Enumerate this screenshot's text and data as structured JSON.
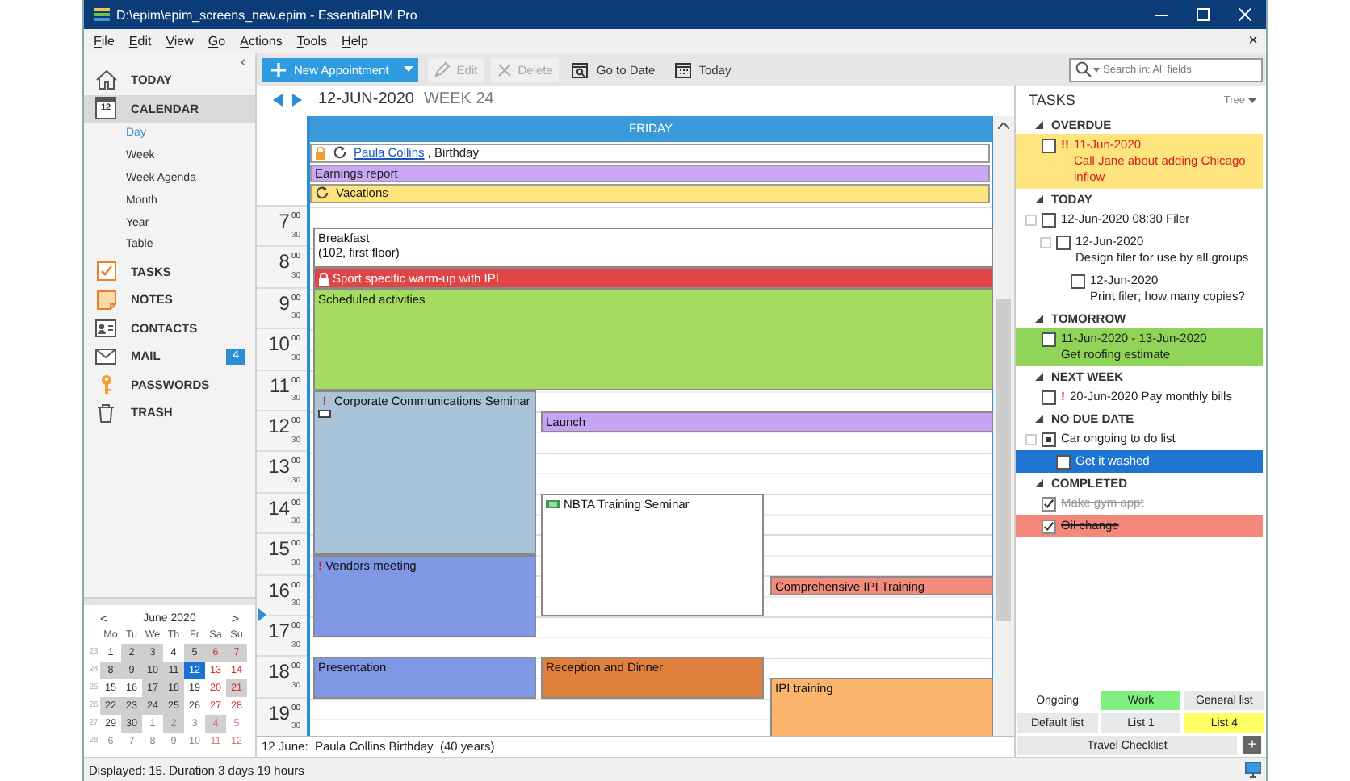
{
  "window": {
    "title": "D:\\epim\\epim_screens_new.epim - EssentialPIM Pro"
  },
  "menu": {
    "items": [
      "File",
      "Edit",
      "View",
      "Go",
      "Actions",
      "Tools",
      "Help"
    ],
    "close": "×"
  },
  "sidebar": {
    "collapse": "‹",
    "items": [
      {
        "label": "TODAY",
        "selected": false
      },
      {
        "label": "CALENDAR",
        "selected": true,
        "icon_label": "12",
        "children": [
          {
            "label": "Day",
            "selected": true
          },
          {
            "label": "Week",
            "selected": false
          },
          {
            "label": "Week Agenda",
            "selected": false
          },
          {
            "label": "Month",
            "selected": false
          },
          {
            "label": "Year",
            "selected": false
          },
          {
            "label": "Table",
            "selected": false
          }
        ]
      },
      {
        "label": "TASKS",
        "selected": false
      },
      {
        "label": "NOTES",
        "selected": false
      },
      {
        "label": "CONTACTS",
        "selected": false
      },
      {
        "label": "MAIL",
        "selected": false,
        "badge": "4"
      },
      {
        "label": "PASSWORDS",
        "selected": false
      },
      {
        "label": "TRASH",
        "selected": false
      }
    ]
  },
  "mini_calendar": {
    "prev": "<",
    "title": "June 2020",
    "next": ">",
    "weekdays": [
      "Mo",
      "Tu",
      "We",
      "Th",
      "Fr",
      "Sa",
      "Su"
    ],
    "weeks": [
      {
        "number": "23",
        "days": [
          {
            "day": "1",
            "other_month": false,
            "busy": false,
            "selected": false
          },
          {
            "day": "2",
            "other_month": false,
            "busy": true,
            "selected": false
          },
          {
            "day": "3",
            "other_month": false,
            "busy": true,
            "selected": false
          },
          {
            "day": "4",
            "other_month": false,
            "busy": false,
            "selected": false
          },
          {
            "day": "5",
            "other_month": false,
            "busy": true,
            "selected": false
          },
          {
            "day": "6",
            "other_month": false,
            "busy": true,
            "selected": false
          },
          {
            "day": "7",
            "other_month": false,
            "busy": true,
            "selected": false
          }
        ]
      },
      {
        "number": "24",
        "days": [
          {
            "day": "8",
            "other_month": false,
            "busy": true,
            "selected": false
          },
          {
            "day": "9",
            "other_month": false,
            "busy": true,
            "selected": false
          },
          {
            "day": "10",
            "other_month": false,
            "busy": true,
            "selected": false
          },
          {
            "day": "11",
            "other_month": false,
            "busy": true,
            "selected": false
          },
          {
            "day": "12",
            "other_month": false,
            "busy": false,
            "selected": true
          },
          {
            "day": "13",
            "other_month": false,
            "busy": false,
            "selected": false
          },
          {
            "day": "14",
            "other_month": false,
            "busy": false,
            "selected": false
          }
        ]
      },
      {
        "number": "25",
        "days": [
          {
            "day": "15",
            "other_month": false,
            "busy": false,
            "selected": false
          },
          {
            "day": "16",
            "other_month": false,
            "busy": false,
            "selected": false
          },
          {
            "day": "17",
            "other_month": false,
            "busy": true,
            "selected": false
          },
          {
            "day": "18",
            "other_month": false,
            "busy": true,
            "selected": false
          },
          {
            "day": "19",
            "other_month": false,
            "busy": false,
            "selected": false
          },
          {
            "day": "20",
            "other_month": false,
            "busy": false,
            "selected": false
          },
          {
            "day": "21",
            "other_month": false,
            "busy": true,
            "selected": false
          }
        ]
      },
      {
        "number": "26",
        "days": [
          {
            "day": "22",
            "other_month": false,
            "busy": true,
            "selected": false
          },
          {
            "day": "23",
            "other_month": false,
            "busy": true,
            "selected": false
          },
          {
            "day": "24",
            "other_month": false,
            "busy": true,
            "selected": false
          },
          {
            "day": "25",
            "other_month": false,
            "busy": true,
            "selected": false
          },
          {
            "day": "26",
            "other_month": false,
            "busy": false,
            "selected": false
          },
          {
            "day": "27",
            "other_month": false,
            "busy": false,
            "selected": false
          },
          {
            "day": "28",
            "other_month": false,
            "busy": false,
            "selected": false
          }
        ]
      },
      {
        "number": "27",
        "days": [
          {
            "day": "29",
            "other_month": false,
            "busy": false,
            "selected": false
          },
          {
            "day": "30",
            "other_month": false,
            "busy": true,
            "selected": false
          },
          {
            "day": "1",
            "other_month": true,
            "busy": false,
            "selected": false
          },
          {
            "day": "2",
            "other_month": true,
            "busy": true,
            "selected": false
          },
          {
            "day": "3",
            "other_month": true,
            "busy": false,
            "selected": false
          },
          {
            "day": "4",
            "other_month": true,
            "busy": true,
            "selected": false
          },
          {
            "day": "5",
            "other_month": true,
            "busy": false,
            "selected": false
          }
        ]
      },
      {
        "number": "28",
        "days": [
          {
            "day": "6",
            "other_month": true,
            "busy": false,
            "selected": false
          },
          {
            "day": "7",
            "other_month": true,
            "busy": false,
            "selected": false
          },
          {
            "day": "8",
            "other_month": true,
            "busy": false,
            "selected": false
          },
          {
            "day": "9",
            "other_month": true,
            "busy": false,
            "selected": false
          },
          {
            "day": "10",
            "other_month": true,
            "busy": false,
            "selected": false
          },
          {
            "day": "11",
            "other_month": true,
            "busy": false,
            "selected": false
          },
          {
            "day": "12",
            "other_month": true,
            "busy": false,
            "selected": false
          }
        ]
      }
    ]
  },
  "toolbar": {
    "new_button": "New Appointment",
    "buttons": [
      {
        "label": "Edit",
        "disabled": true
      },
      {
        "label": "Delete",
        "disabled": true
      },
      {
        "label": "Go to Date",
        "disabled": false
      },
      {
        "label": "Today",
        "disabled": false
      }
    ],
    "search": {
      "placeholder": "Search in: All fields"
    }
  },
  "calendar": {
    "date": "12-JUN-2020",
    "week": "WEEK 24",
    "day_name": "FRIDAY",
    "all_day": [
      {
        "link": "Paula Collins",
        "title": ", Birthday",
        "color": "#ffffff",
        "locked": true,
        "recurring": true
      },
      {
        "title": "Earnings report",
        "color": "#c9a7f4",
        "locked": false,
        "recurring": false
      },
      {
        "title": "Vacations",
        "color": "#fde47c",
        "locked": false,
        "recurring": true
      }
    ],
    "hours": [
      {
        "hour": "7",
        "minutes": "00",
        "half": "30"
      },
      {
        "hour": "8",
        "minutes": "00",
        "half": "30"
      },
      {
        "hour": "9",
        "minutes": "00",
        "half": "30"
      },
      {
        "hour": "10",
        "minutes": "00",
        "half": "30"
      },
      {
        "hour": "11",
        "minutes": "00",
        "half": "30"
      },
      {
        "hour": "12",
        "minutes": "00",
        "half": "30"
      },
      {
        "hour": "13",
        "minutes": "00",
        "half": "30"
      },
      {
        "hour": "14",
        "minutes": "00",
        "half": "30"
      },
      {
        "hour": "15",
        "minutes": "00",
        "half": "30"
      },
      {
        "hour": "16",
        "minutes": "00",
        "half": "30"
      },
      {
        "hour": "17",
        "minutes": "00",
        "half": "30"
      },
      {
        "hour": "18",
        "minutes": "00",
        "half": "30"
      },
      {
        "hour": "19",
        "minutes": "00",
        "half": "30"
      }
    ],
    "events": [
      {
        "lines": [
          "Breakfast",
          "(102, first floor)"
        ],
        "color": "#ffffff",
        "locked": false,
        "note": false,
        "category": false
      },
      {
        "lines": [
          "Sport specific warm-up with IPI"
        ],
        "color": "#e14444",
        "locked": true,
        "note": false,
        "category": false
      },
      {
        "lines": [
          "Scheduled activities"
        ],
        "color": "#a6dc5f",
        "locked": false,
        "note": false,
        "category": false
      },
      {
        "lines": [
          "Corporate Communications Seminar"
        ],
        "color": "#a9c4d8",
        "locked": false,
        "priority": "!",
        "note": true,
        "category": false
      },
      {
        "lines": [
          "Launch"
        ],
        "color": "#c5a4f4",
        "locked": false,
        "note": false,
        "category": false
      },
      {
        "lines": [
          "NBTA Training Seminar"
        ],
        "color": "#ffffff",
        "locked": false,
        "note": false,
        "category": true
      },
      {
        "lines": [
          "Vendors meeting"
        ],
        "color": "#7f97e4",
        "locked": false,
        "priority": "!",
        "note": false,
        "category": false
      },
      {
        "lines": [
          "Comprehensive IPI Training"
        ],
        "color": "#f28b7b",
        "locked": false,
        "note": false,
        "category": false
      },
      {
        "lines": [
          "Presentation"
        ],
        "color": "#7f97e4",
        "locked": false,
        "note": false,
        "category": false
      },
      {
        "lines": [
          "Reception and Dinner"
        ],
        "color": "#e0803f",
        "locked": false,
        "note": false,
        "category": false
      },
      {
        "lines": [
          "IPI training"
        ],
        "color": "#fbb46b",
        "locked": false,
        "note": false,
        "category": false
      }
    ],
    "info": "12 June:  Paula Collins Birthday  (40 years)"
  },
  "tasks": {
    "title": "TASKS",
    "view": "Tree",
    "groups": [
      {
        "label": "OVERDUE",
        "kind": "overdue",
        "expanded": true,
        "tasks": [
          {
            "lines": [
              "11-Jun-2020",
              "Call Jane about adding Chicago inflow"
            ],
            "priority": "!!",
            "checked": false,
            "partial": false,
            "selected": false,
            "color": "#fde47c"
          }
        ]
      },
      {
        "label": "TODAY",
        "kind": "today",
        "expanded": true,
        "tasks": [
          {
            "lines": [
              "12-Jun-2020 08:30 Filer"
            ],
            "checked": false,
            "partial": false,
            "selected": false,
            "children": [
              {
                "lines": [
                  "12-Jun-2020",
                  "Design filer for use by all groups"
                ],
                "checked": false,
                "partial": false,
                "selected": false,
                "children": [
                  {
                    "lines": [
                      "12-Jun-2020",
                      "Print filer; how many copies?"
                    ],
                    "checked": false,
                    "partial": false,
                    "selected": false
                  }
                ]
              }
            ]
          }
        ]
      },
      {
        "label": "TOMORROW",
        "kind": "tomorrow",
        "expanded": true,
        "tasks": [
          {
            "lines": [
              "11-Jun-2020 - 13-Jun-2020",
              "Get roofing estimate"
            ],
            "checked": false,
            "partial": false,
            "selected": false,
            "color": "#8fd457"
          }
        ]
      },
      {
        "label": "NEXT WEEK",
        "kind": "next_week",
        "expanded": true,
        "tasks": [
          {
            "lines": [
              "20-Jun-2020 Pay monthly bills"
            ],
            "priority": "!",
            "checked": false,
            "partial": false,
            "selected": false
          }
        ]
      },
      {
        "label": "NO DUE DATE",
        "kind": "no_date",
        "expanded": true,
        "tasks": [
          {
            "lines": [
              "Car ongoing to do list"
            ],
            "checked": false,
            "partial": true,
            "selected": false,
            "children": [
              {
                "lines": [
                  "Get it washed"
                ],
                "checked": false,
                "partial": false,
                "selected": true
              }
            ]
          }
        ]
      },
      {
        "label": "COMPLETED",
        "kind": "completed",
        "expanded": true,
        "tasks": [
          {
            "lines": [
              "Make gym appt"
            ],
            "checked": true,
            "partial": false,
            "selected": false
          },
          {
            "lines": [
              "Oil change"
            ],
            "checked": true,
            "partial": false,
            "selected": false,
            "color": "#f4887a"
          }
        ]
      }
    ],
    "lists": [
      [
        {
          "label": "Ongoing",
          "selected": true
        },
        {
          "label": "Work",
          "selected": false,
          "color": "#80ef80"
        },
        {
          "label": "General list",
          "selected": false
        }
      ],
      [
        {
          "label": "Default list",
          "selected": false
        },
        {
          "label": "List 1",
          "selected": false
        },
        {
          "label": "List 4",
          "selected": false,
          "color": "#ffff66"
        }
      ]
    ],
    "footer": {
      "label": "Travel Checklist",
      "add": "+"
    }
  },
  "status": "Displayed: 15. Duration 3 days 19 hours"
}
